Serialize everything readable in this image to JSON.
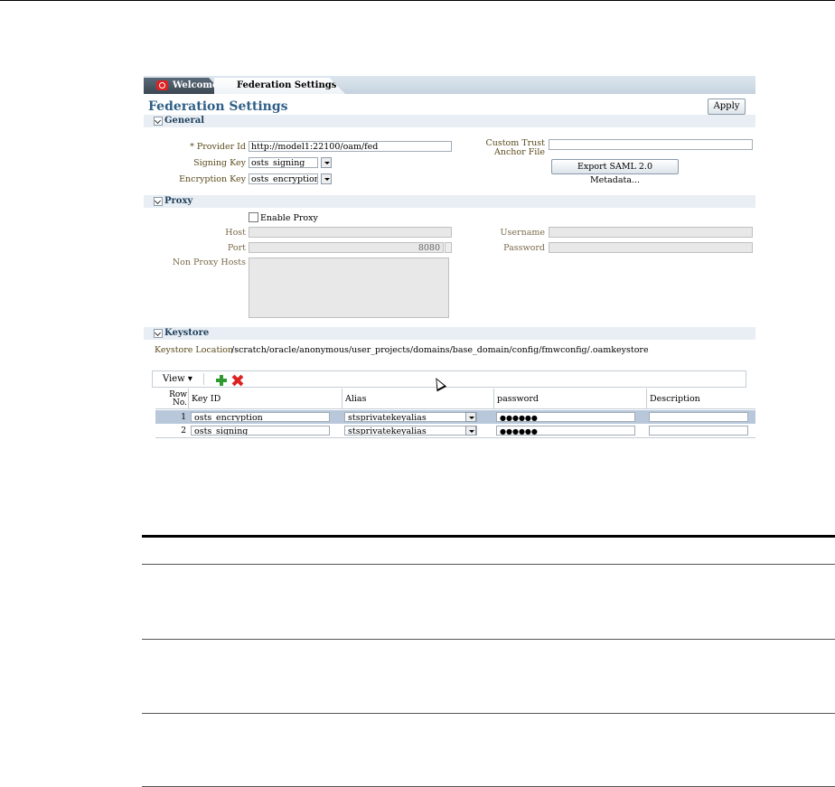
{
  "tabs": [
    {
      "label": "Welcome"
    },
    {
      "label": "Federation Settings"
    }
  ],
  "page": {
    "title": "Federation Settings",
    "apply_label": "Apply"
  },
  "general": {
    "header": "General",
    "provider_id_label": "* Provider Id",
    "provider_id_value": "http://model1:22100/oam/fed",
    "signing_key_label": "Signing Key",
    "signing_key_value": "osts_signing",
    "encryption_key_label": "Encryption Key",
    "encryption_key_value": "osts_encryption",
    "custom_trust_label_1": "Custom Trust",
    "custom_trust_label_2": "Anchor File",
    "custom_trust_value": "",
    "export_button_label": "Export SAML 2.0 Metadata..."
  },
  "proxy": {
    "header": "Proxy",
    "enable_label": "Enable Proxy",
    "host_label": "Host",
    "port_label": "Port",
    "port_value": "8080",
    "non_proxy_label": "Non Proxy Hosts",
    "username_label": "Username",
    "password_label": "Password"
  },
  "keystore": {
    "header": "Keystore",
    "location_label": "Keystore Location",
    "location_value": "/scratch/oracle/anonymous/user_projects/domains/base_domain/config/fmwconfig/.oamkeystore",
    "view_menu": "View ▾",
    "columns": {
      "row_no_1": "Row",
      "row_no_2": "No.",
      "key_id": "Key ID",
      "alias": "Alias",
      "password": "password",
      "description": "Description"
    },
    "rows": [
      {
        "no": "1",
        "key_id": "osts_encryption",
        "alias": "stsprivatekeyalias",
        "password": "●●●●●●",
        "description": ""
      },
      {
        "no": "2",
        "key_id": "osts_signing",
        "alias": "stsprivatekeyalias",
        "password": "●●●●●●",
        "description": ""
      }
    ],
    "selected_row_color": "#b8c8da"
  },
  "colors": {
    "accent": "#2f5f86",
    "label": "#5a4a1a",
    "section_bg": "#e8eef3"
  }
}
